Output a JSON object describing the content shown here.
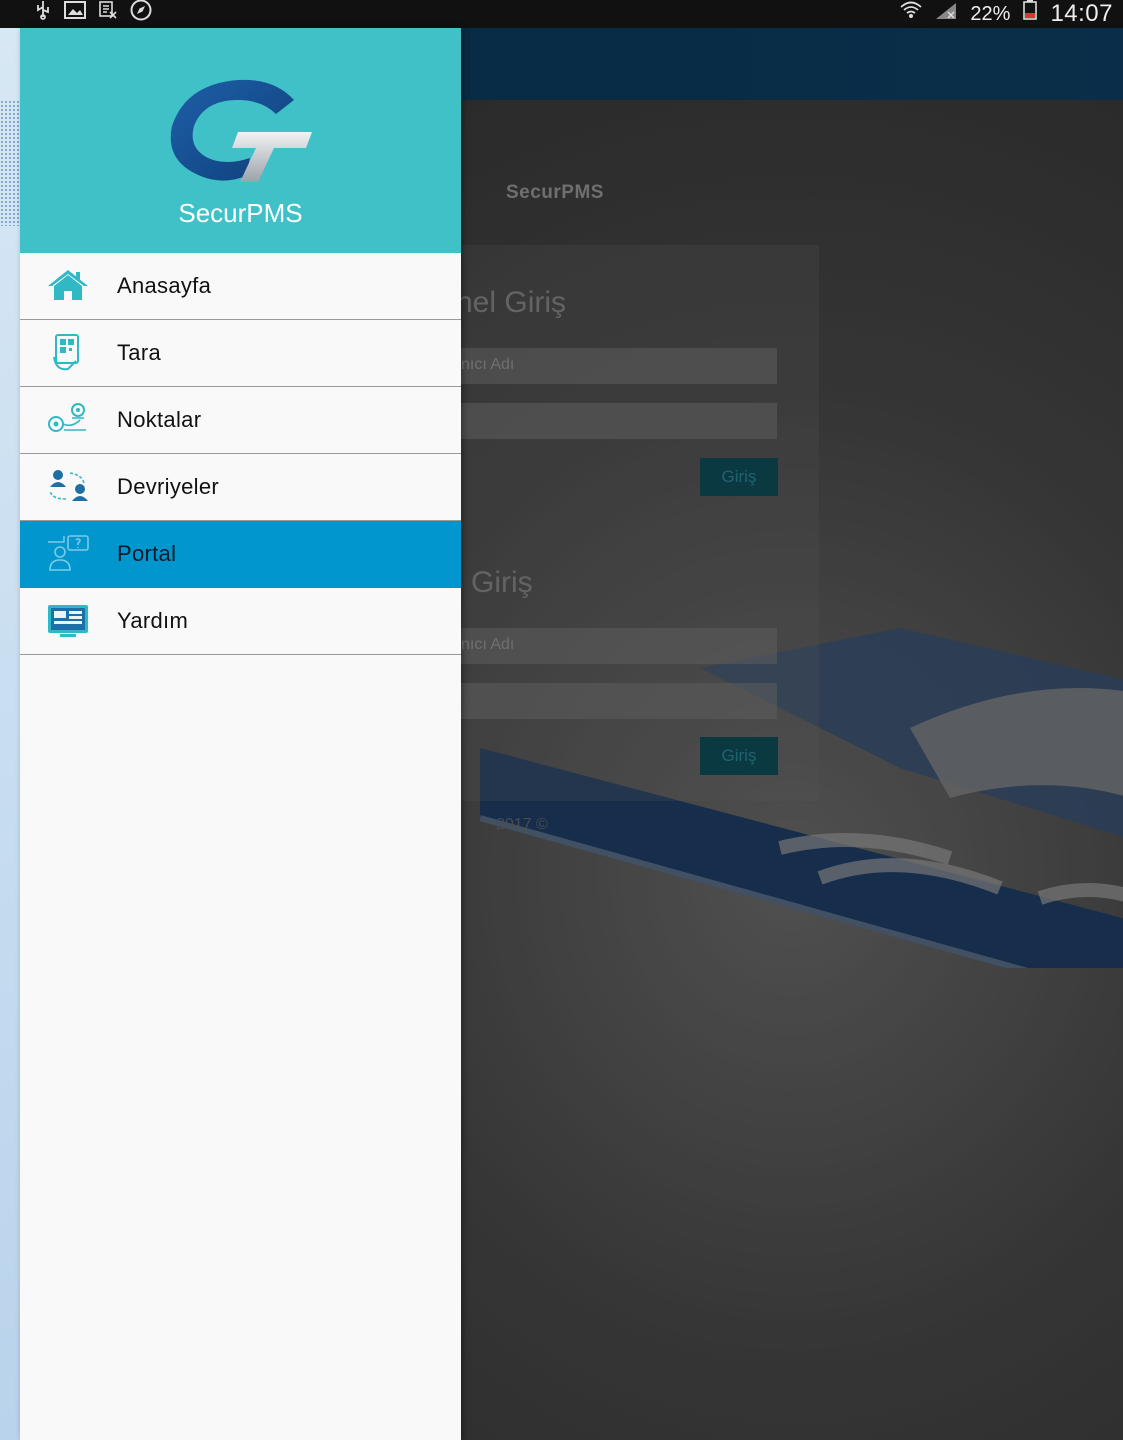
{
  "status_bar": {
    "battery_percent": "22%",
    "time": "14:07",
    "left_icons": [
      "usb-icon",
      "image-icon",
      "screenshot-icon",
      "compass-icon"
    ],
    "right_icons": [
      "wifi-icon",
      "signal-icon",
      "battery-icon"
    ]
  },
  "background_app": {
    "brand": "SecurPMS",
    "section1_title": "nel Giriş",
    "section1_username_placeholder": "nıcı Adı",
    "section1_button": "Giriş",
    "section2_title": "i Giriş",
    "section2_username_placeholder": "nıcı Adı",
    "section2_button": "Giriş",
    "footer": "2017 ©"
  },
  "drawer": {
    "title": "SecurPMS",
    "items": [
      {
        "label": "Anasayfa",
        "icon": "home-icon",
        "active": false
      },
      {
        "label": "Tara",
        "icon": "qr-scan-icon",
        "active": false
      },
      {
        "label": "Noktalar",
        "icon": "location-points-icon",
        "active": false
      },
      {
        "label": "Devriyeler",
        "icon": "patrol-users-icon",
        "active": false
      },
      {
        "label": "Portal",
        "icon": "portal-support-icon",
        "active": true
      },
      {
        "label": "Yardım",
        "icon": "help-screen-icon",
        "active": false
      }
    ],
    "colors": {
      "header": "#40c1c8",
      "active_item": "#0296cf",
      "icon_teal": "#2fb9c4"
    }
  }
}
